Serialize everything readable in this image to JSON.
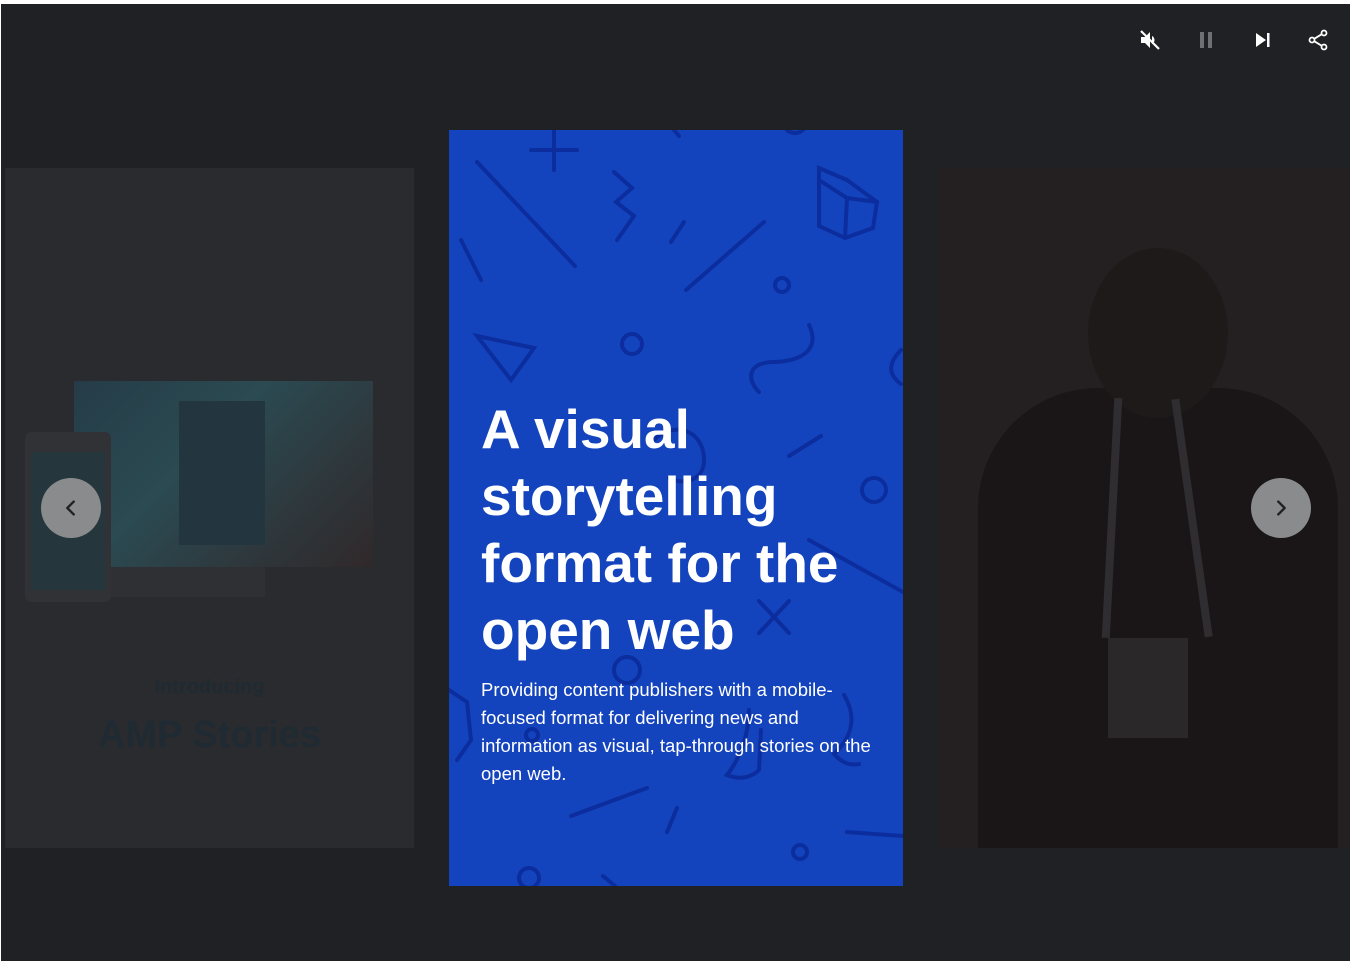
{
  "controls": {
    "mute_icon": "volume-off-icon",
    "pause_icon": "pause-icon",
    "skip_icon": "skip-next-icon",
    "share_icon": "share-icon"
  },
  "prev_page": {
    "intro": "Introducing",
    "title": "AMP Stories"
  },
  "current_page": {
    "heading": "A visual storytelling format for the open web",
    "description": "Providing content publishers with a mobile-focused format for delivering news and information as visual, tap-through stories on the open web."
  },
  "navigation": {
    "prev_icon": "chevron-left-icon",
    "next_icon": "chevron-right-icon"
  },
  "colors": {
    "background": "#202124",
    "page_accent": "#1444bd",
    "pattern_stroke": "#0a2a9a",
    "nav_button": "#8a8b8d"
  }
}
